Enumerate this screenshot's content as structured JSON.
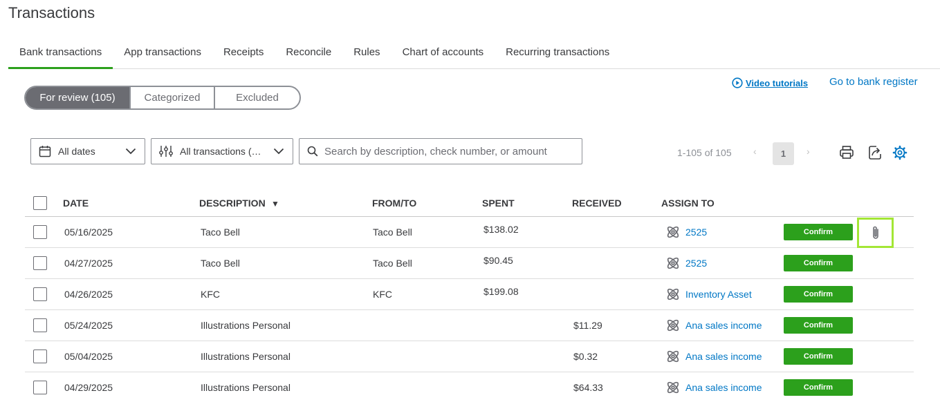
{
  "page": {
    "title": "Transactions"
  },
  "tabs": [
    {
      "label": "Bank transactions",
      "active": true
    },
    {
      "label": "App transactions"
    },
    {
      "label": "Receipts"
    },
    {
      "label": "Reconcile"
    },
    {
      "label": "Rules"
    },
    {
      "label": "Chart of accounts"
    },
    {
      "label": "Recurring transactions"
    }
  ],
  "links": {
    "video_tutorials": "Video tutorials",
    "bank_register": "Go to bank register"
  },
  "segments": [
    {
      "label": "For review (105)",
      "active": true
    },
    {
      "label": "Categorized"
    },
    {
      "label": "Excluded"
    }
  ],
  "filters": {
    "dates": {
      "label": "All dates",
      "icon": "calendar-icon"
    },
    "transactions": {
      "label": "All transactions (…",
      "icon": "sliders-icon"
    }
  },
  "search": {
    "placeholder": "Search by description, check number, or amount",
    "value": ""
  },
  "pagination": {
    "summary": "1-105 of 105",
    "current_page": "1",
    "prev": "‹",
    "next": "›"
  },
  "toolbar_icons": [
    "print-icon",
    "export-icon",
    "settings-gear-icon"
  ],
  "table": {
    "headers": {
      "date": "DATE",
      "description": "DESCRIPTION",
      "sort_indicator": "▼",
      "from_to": "FROM/TO",
      "spent": "SPENT",
      "received": "RECEIVED",
      "assign_to": "ASSIGN TO"
    },
    "confirm_label": "Confirm",
    "rows": [
      {
        "date": "05/16/2025",
        "description": "Taco Bell",
        "from_to": "Taco Bell",
        "spent": "$138.02",
        "received": "",
        "assign_to": "2525",
        "attachment": true
      },
      {
        "date": "04/27/2025",
        "description": "Taco Bell",
        "from_to": "Taco Bell",
        "spent": "$90.45",
        "received": "",
        "assign_to": "2525"
      },
      {
        "date": "04/26/2025",
        "description": "KFC",
        "from_to": "KFC",
        "spent": "$199.08",
        "received": "",
        "assign_to": "Inventory Asset"
      },
      {
        "date": "05/24/2025",
        "description": "Illustrations Personal",
        "from_to": "",
        "spent": "",
        "received": "$11.29",
        "assign_to": "Ana sales income"
      },
      {
        "date": "05/04/2025",
        "description": "Illustrations Personal",
        "from_to": "",
        "spent": "",
        "received": "$0.32",
        "assign_to": "Ana sales income"
      },
      {
        "date": "04/29/2025",
        "description": "Illustrations Personal",
        "from_to": "",
        "spent": "",
        "received": "$64.33",
        "assign_to": "Ana sales income"
      }
    ]
  },
  "colors": {
    "accent_green": "#2ca01c",
    "link_blue": "#0077c5",
    "highlight": "#a3e635"
  }
}
